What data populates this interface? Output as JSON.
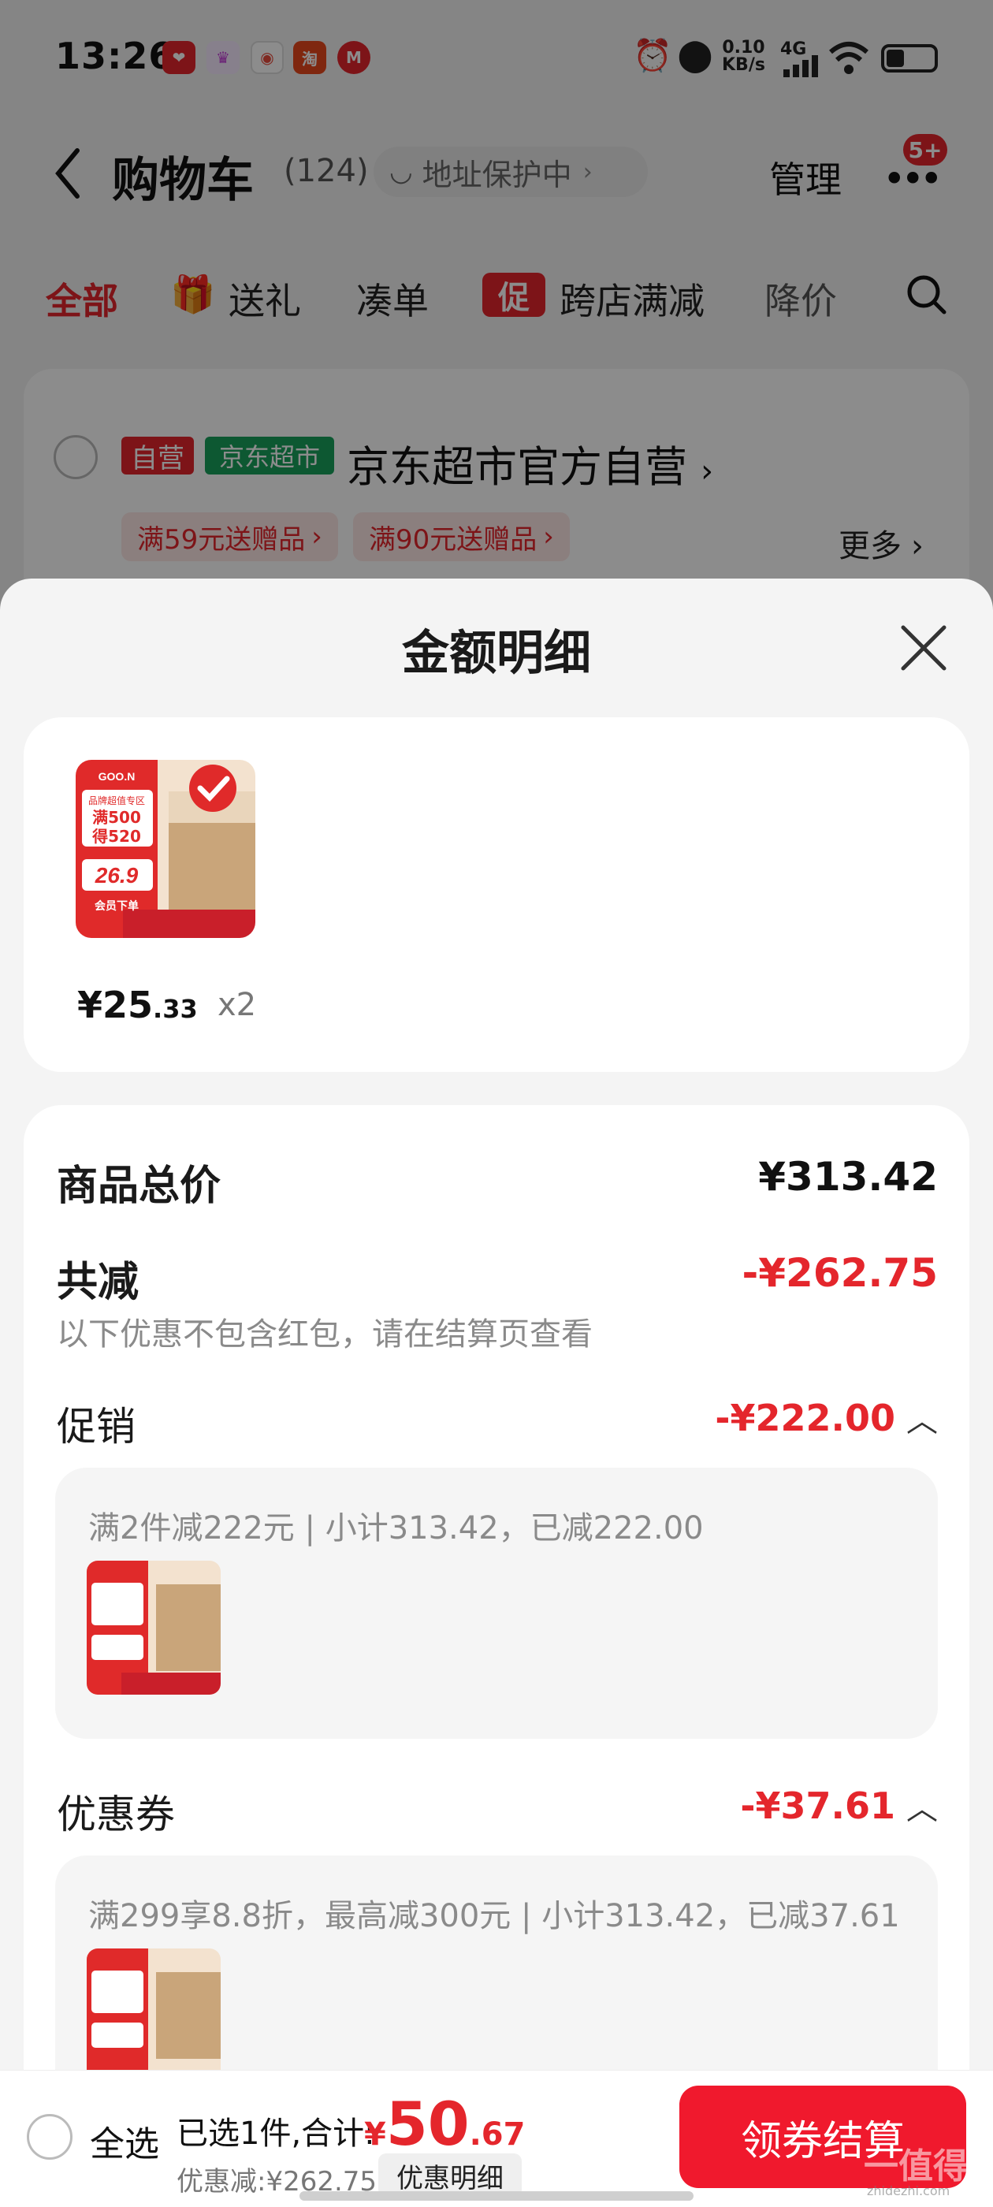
{
  "status_bar": {
    "time": "13:26",
    "net_speed_value": "0.10",
    "net_speed_unit": "KB/s",
    "signal": "4G",
    "apps": [
      {
        "icon": "app-red-icon",
        "color": "#e4262c"
      },
      {
        "icon": "app-crown-icon",
        "color": "#f0a020"
      },
      {
        "icon": "app-map-icon",
        "color": "#e84b3c"
      },
      {
        "icon": "taobao-icon",
        "color": "#e8481c",
        "text": "淘"
      },
      {
        "icon": "metro-icon",
        "color": "#e4262c",
        "text": "M"
      }
    ]
  },
  "header": {
    "title": "购物车",
    "count": "(124)",
    "address_pill": "地址保护中",
    "manage": "管理",
    "badge": "5+"
  },
  "tabs": {
    "all": "全部",
    "gift": "送礼",
    "bundle": "凑单",
    "cuxiao_badge": "促",
    "cross_store": "跨店满减",
    "price_drop": "降价"
  },
  "store": {
    "tag_self": "自营",
    "tag_jd": "京东超市",
    "name": "京东超市官方自营",
    "promos": [
      "满59元送赠品",
      "满90元送赠品"
    ],
    "more": "更多"
  },
  "sheet": {
    "title": "金额明细",
    "product": {
      "price_int": "¥25",
      "price_dec": ".33",
      "qty": "x2",
      "img_text": {
        "brand": "GOO.N",
        "line1": "品牌超值专区",
        "line2": "满500",
        "line3": "得520",
        "price": "26.9",
        "cta": "会员下单"
      }
    },
    "total_label": "商品总价",
    "total_value": "¥313.42",
    "reduce_label": "共减",
    "reduce_value": "-¥262.75",
    "reduce_note": "以下优惠不包含红包，请在结算页查看",
    "promo_label": "促销",
    "promo_value": "-¥222.00",
    "promo_detail": "满2件减222元 | 小计313.42，已减222.00",
    "coupon_label": "优惠券",
    "coupon_value": "-¥37.61",
    "coupon_detail": "满299享8.8折，最高减300元 | 小计313.42，已减37.61"
  },
  "bottom": {
    "select_all": "全选",
    "selected": "已选1件,合计:",
    "currency": "¥",
    "total_int": "50",
    "total_dec": ".67",
    "discount": "优惠减:¥262.75",
    "detail_btn": "优惠明细",
    "checkout": "领券结算",
    "watermark": "一值得买",
    "watermark_url": "zhidezhi.com"
  }
}
